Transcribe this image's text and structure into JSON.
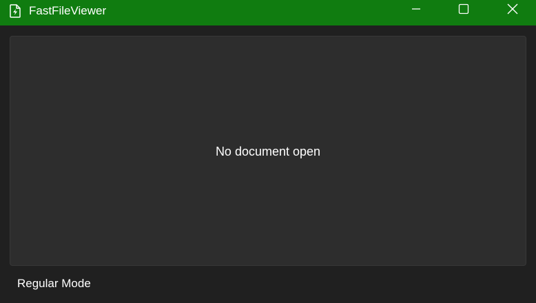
{
  "window": {
    "title": "FastFileViewer",
    "accent_color": "#107c10",
    "controls": {
      "minimize_icon": "minimize-icon",
      "maximize_icon": "maximize-icon",
      "close_icon": "close-icon"
    }
  },
  "viewer": {
    "empty_message": "No document open"
  },
  "status": {
    "mode": "Regular Mode"
  }
}
